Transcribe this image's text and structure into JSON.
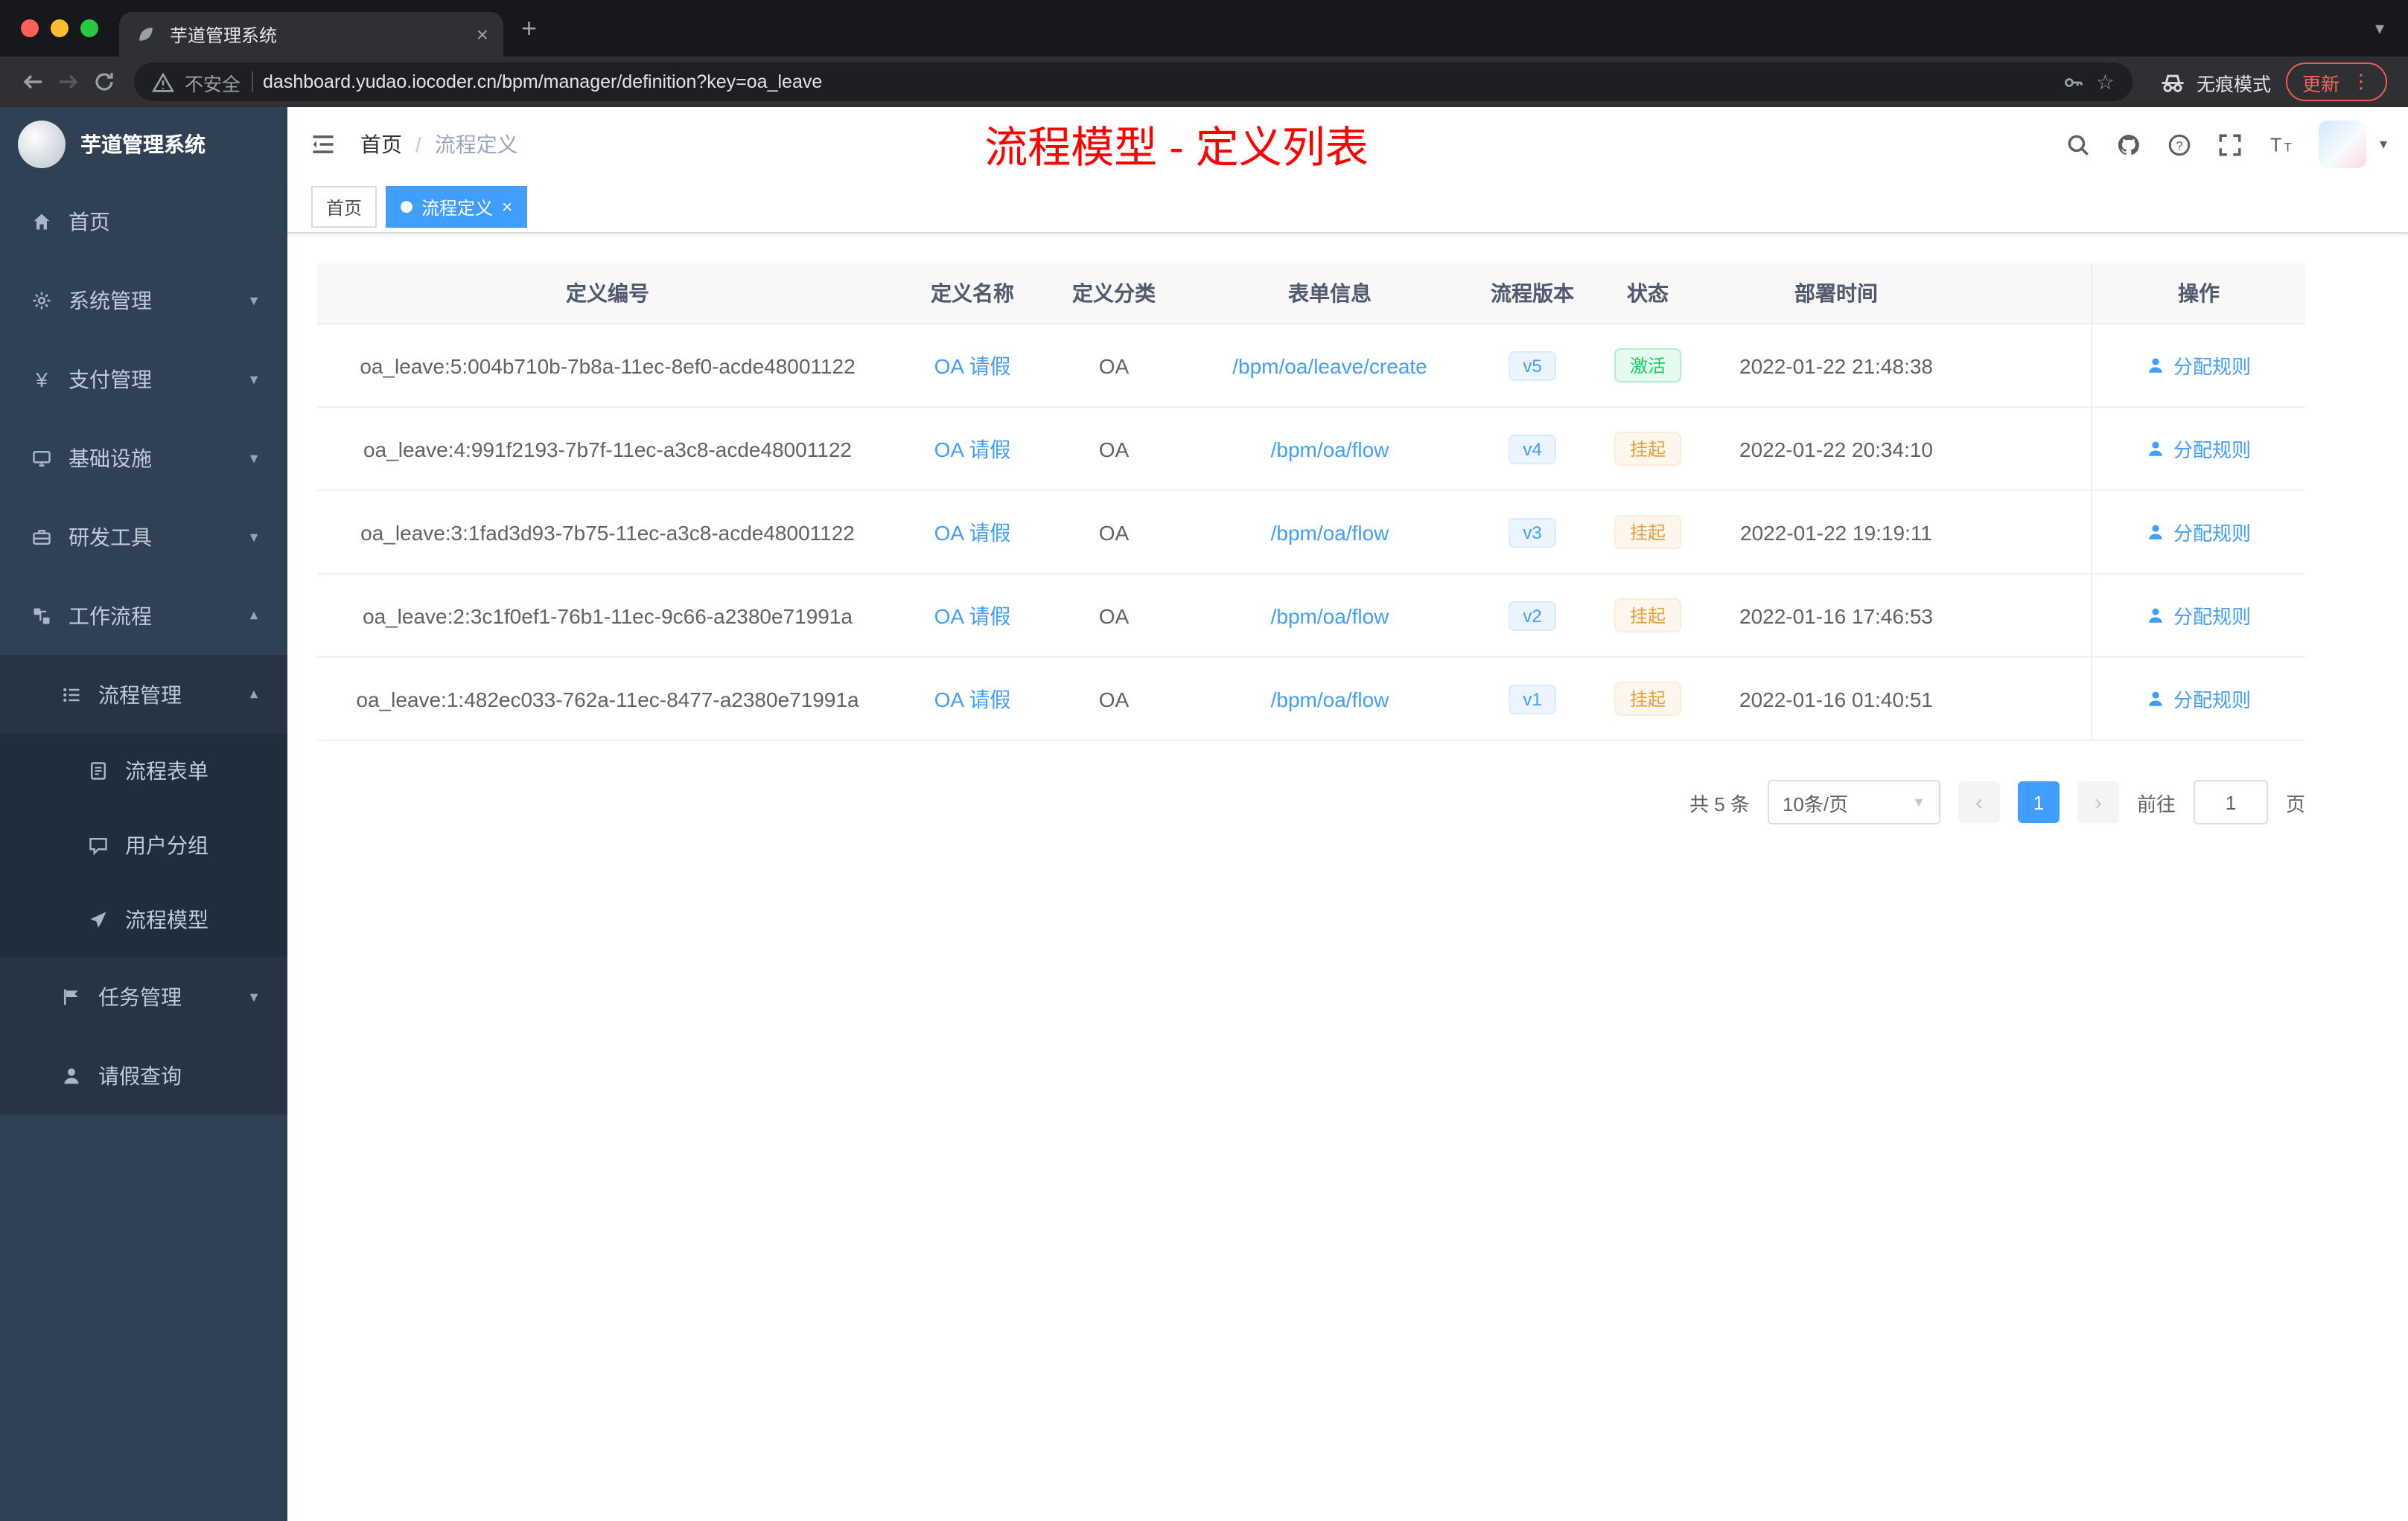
{
  "browser": {
    "tab_title": "芋道管理系统",
    "security_label": "不安全",
    "url": "dashboard.yudao.iocoder.cn/bpm/manager/definition?key=oa_leave",
    "incognito_label": "无痕模式",
    "update_label": "更新"
  },
  "sidebar": {
    "logo_title": "芋道管理系统",
    "items": [
      {
        "label": "首页",
        "icon": "home",
        "level": 1
      },
      {
        "label": "系统管理",
        "icon": "gear",
        "level": 1,
        "chevron": "down"
      },
      {
        "label": "支付管理",
        "icon": "yen",
        "level": 1,
        "chevron": "down"
      },
      {
        "label": "基础设施",
        "icon": "monitor",
        "level": 1,
        "chevron": "down"
      },
      {
        "label": "研发工具",
        "icon": "toolbox",
        "level": 1,
        "chevron": "down"
      },
      {
        "label": "工作流程",
        "icon": "workflow",
        "level": 1,
        "chevron": "up"
      },
      {
        "label": "流程管理",
        "icon": "listdot",
        "level": 2,
        "chevron": "up"
      },
      {
        "label": "流程表单",
        "icon": "form",
        "level": 3
      },
      {
        "label": "用户分组",
        "icon": "chat",
        "level": 3
      },
      {
        "label": "流程模型",
        "icon": "send",
        "level": 3
      },
      {
        "label": "任务管理",
        "icon": "flag",
        "level": 2,
        "chevron": "down"
      },
      {
        "label": "请假查询",
        "icon": "person",
        "level": 2
      }
    ]
  },
  "header": {
    "breadcrumb": {
      "home": "首页",
      "sep": "/",
      "current": "流程定义"
    },
    "overlay_title": "流程模型 - 定义列表"
  },
  "tags": [
    {
      "label": "首页",
      "active": false,
      "closable": false
    },
    {
      "label": "流程定义",
      "active": true,
      "closable": true
    }
  ],
  "table": {
    "columns": [
      "定义编号",
      "定义名称",
      "定义分类",
      "表单信息",
      "流程版本",
      "状态",
      "部署时间",
      "操作"
    ],
    "rows": [
      {
        "id": "oa_leave:5:004b710b-7b8a-11ec-8ef0-acde48001122",
        "name": "OA 请假",
        "category": "OA",
        "form": "/bpm/oa/leave/create",
        "version": "v5",
        "status": "激活",
        "status_type": "success",
        "deploy_time": "2022-01-22 21:48:38",
        "action": "分配规则"
      },
      {
        "id": "oa_leave:4:991f2193-7b7f-11ec-a3c8-acde48001122",
        "name": "OA 请假",
        "category": "OA",
        "form": "/bpm/oa/flow",
        "version": "v4",
        "status": "挂起",
        "status_type": "warning",
        "deploy_time": "2022-01-22 20:34:10",
        "action": "分配规则"
      },
      {
        "id": "oa_leave:3:1fad3d93-7b75-11ec-a3c8-acde48001122",
        "name": "OA 请假",
        "category": "OA",
        "form": "/bpm/oa/flow",
        "version": "v3",
        "status": "挂起",
        "status_type": "warning",
        "deploy_time": "2022-01-22 19:19:11",
        "action": "分配规则"
      },
      {
        "id": "oa_leave:2:3c1f0ef1-76b1-11ec-9c66-a2380e71991a",
        "name": "OA 请假",
        "category": "OA",
        "form": "/bpm/oa/flow",
        "version": "v2",
        "status": "挂起",
        "status_type": "warning",
        "deploy_time": "2022-01-16 17:46:53",
        "action": "分配规则"
      },
      {
        "id": "oa_leave:1:482ec033-762a-11ec-8477-a2380e71991a",
        "name": "OA 请假",
        "category": "OA",
        "form": "/bpm/oa/flow",
        "version": "v1",
        "status": "挂起",
        "status_type": "warning",
        "deploy_time": "2022-01-16 01:40:51",
        "action": "分配规则"
      }
    ]
  },
  "pagination": {
    "total": "共 5 条",
    "page_size": "10条/页",
    "current_page": "1",
    "goto_label": "前往",
    "goto_value": "1",
    "page_unit": "页"
  }
}
